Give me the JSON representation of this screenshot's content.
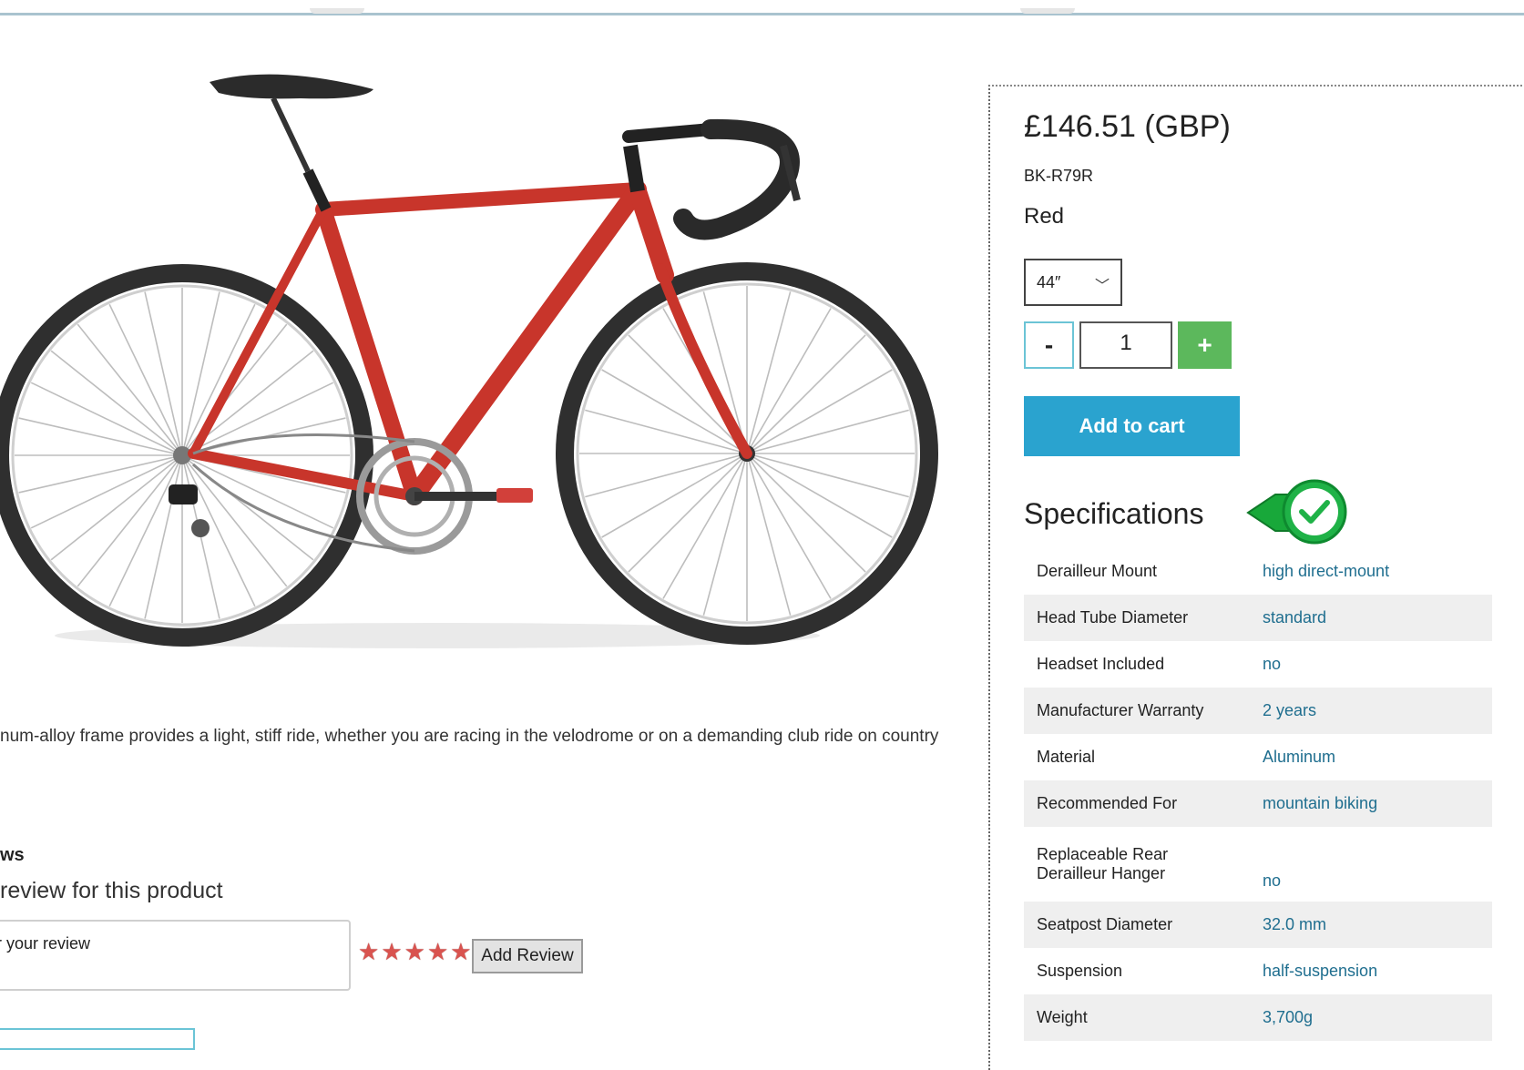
{
  "product": {
    "price": "£146.51 (GBP)",
    "sku": "BK-R79R",
    "color": "Red",
    "size_selected": "44″",
    "quantity": "1",
    "minus_label": "-",
    "plus_label": "+",
    "add_to_cart": "Add to cart",
    "description": "num-alloy frame provides a light, stiff ride, whether you are racing in the velodrome or on a demanding club ride on country"
  },
  "specifications": {
    "title": "Specifications",
    "rows": [
      {
        "key": "Derailleur Mount",
        "value": "high direct-mount"
      },
      {
        "key": "Head Tube Diameter",
        "value": "standard"
      },
      {
        "key": "Headset Included",
        "value": "no"
      },
      {
        "key": "Manufacturer Warranty",
        "value": "2 years"
      },
      {
        "key": "Material",
        "value": "Aluminum"
      },
      {
        "key": "Recommended For",
        "value": "mountain biking"
      },
      {
        "key": "Replaceable Rear Derailleur Hanger",
        "value": "no"
      },
      {
        "key": "Seatpost Diameter",
        "value": "32.0 mm"
      },
      {
        "key": "Suspension",
        "value": "half-suspension"
      },
      {
        "key": "Weight",
        "value": "3,700g"
      }
    ]
  },
  "reviews": {
    "heading": "ws",
    "subheading": "review for this product",
    "input_value": "r your review",
    "rating": 5,
    "add_review": "Add Review"
  },
  "colors": {
    "accent_blue": "#2aa3cf",
    "plus_green": "#5cb85c",
    "spec_value": "#1f6e8f",
    "frame_red": "#c8352b"
  }
}
